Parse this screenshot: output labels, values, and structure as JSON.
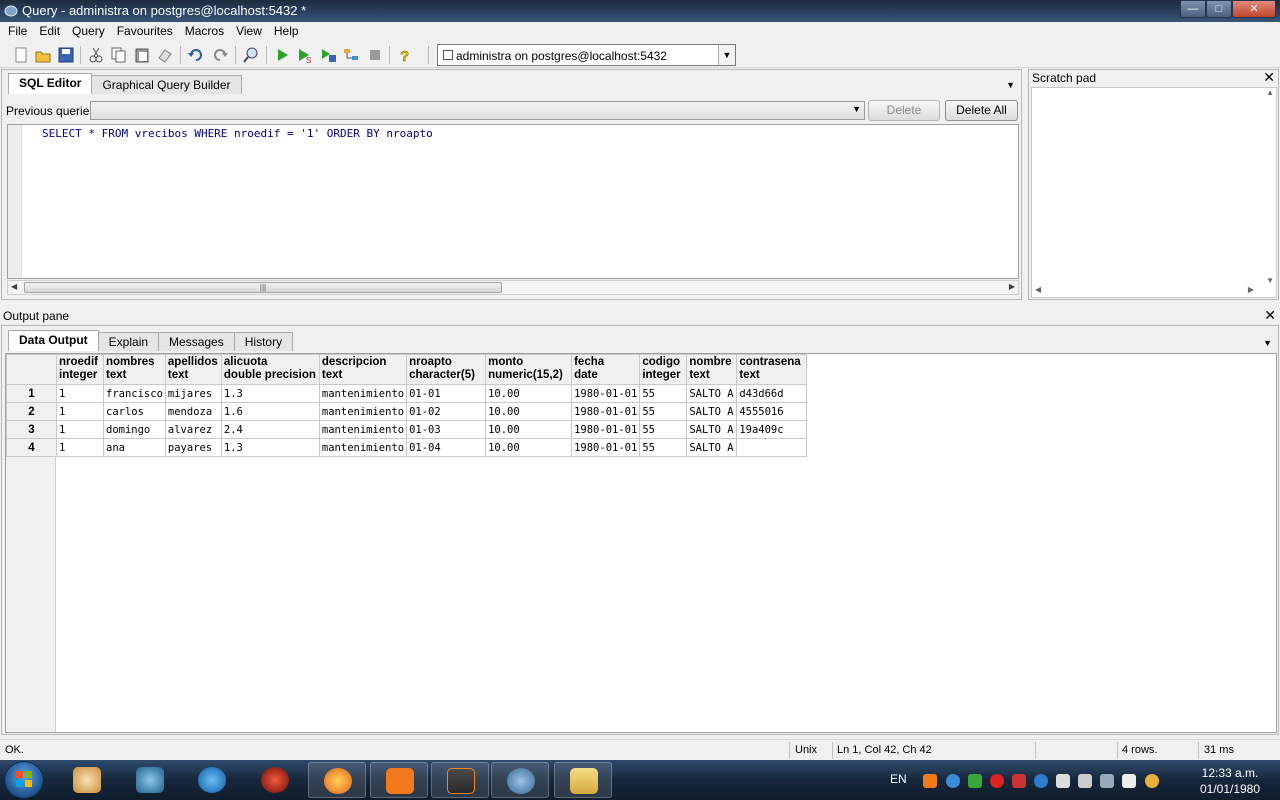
{
  "window": {
    "title": "Query - administra on postgres@localhost:5432 *",
    "minimize": "—",
    "maximize": "□",
    "close": "✕"
  },
  "menu": [
    "File",
    "Edit",
    "Query",
    "Favourites",
    "Macros",
    "View",
    "Help"
  ],
  "toolbar": {
    "icons": [
      "new-icon",
      "open-icon",
      "save-icon",
      "cut-icon",
      "copy-icon",
      "paste-icon",
      "clear-icon",
      "undo-icon",
      "redo-icon",
      "find-icon",
      "execute-icon",
      "execute-pgscript-icon",
      "execute-to-file-icon",
      "explain-icon",
      "cancel-icon",
      "help-icon"
    ],
    "connection": "administra on postgres@localhost:5432"
  },
  "editor": {
    "tabs": [
      "SQL Editor",
      "Graphical Query Builder"
    ],
    "active_tab": "SQL Editor",
    "previous_queries_label": "Previous queries",
    "previous_queries_value": "",
    "delete_label": "Delete",
    "delete_all_label": "Delete All",
    "sql": "SELECT * FROM vrecibos WHERE nroedif = '1' ORDER BY nroapto",
    "scroll_thumb": "|||"
  },
  "scratch_pad": {
    "title": "Scratch pad",
    "close": "✕"
  },
  "output": {
    "title": "Output pane",
    "close": "✕",
    "tabs": [
      "Data Output",
      "Explain",
      "Messages",
      "History"
    ],
    "active_tab": "Data Output",
    "columns": [
      {
        "name": "nroedif",
        "type": "integer"
      },
      {
        "name": "nombres",
        "type": "text"
      },
      {
        "name": "apellidos",
        "type": "text"
      },
      {
        "name": "alicuota",
        "type": "double precision"
      },
      {
        "name": "descripcion",
        "type": "text"
      },
      {
        "name": "nroapto",
        "type": "character(5)"
      },
      {
        "name": "monto",
        "type": "numeric(15,2)"
      },
      {
        "name": "fecha",
        "type": "date"
      },
      {
        "name": "codigo",
        "type": "integer"
      },
      {
        "name": "nombre",
        "type": "text"
      },
      {
        "name": "contrasena",
        "type": "text"
      }
    ],
    "rows": [
      {
        "num": "1",
        "cells": [
          "1",
          "francisco",
          "mijares",
          "1.3",
          "mantenimiento",
          "01-01",
          "10.00",
          "1980-01-01",
          "55",
          "SALTO A",
          "d43d66d"
        ]
      },
      {
        "num": "2",
        "cells": [
          "1",
          "carlos",
          "mendoza",
          "1.6",
          "mantenimiento",
          "01-02",
          "10.00",
          "1980-01-01",
          "55",
          "SALTO A",
          "4555016"
        ]
      },
      {
        "num": "3",
        "cells": [
          "1",
          "domingo",
          "alvarez",
          "2.4",
          "mantenimiento",
          "01-03",
          "10.00",
          "1980-01-01",
          "55",
          "SALTO A",
          "19a409c"
        ]
      },
      {
        "num": "4",
        "cells": [
          "1",
          "ana",
          "payares",
          "1.3",
          "mantenimiento",
          "01-04",
          "10.00",
          "1980-01-01",
          "55",
          "SALTO A",
          ""
        ]
      }
    ]
  },
  "status": {
    "message": "OK.",
    "line_endings": "Unix",
    "position": "Ln 1, Col 42, Ch 42",
    "rows": "4 rows.",
    "time": "31 ms"
  },
  "taskbar": {
    "apps": [
      "paint-app",
      "arduino-app",
      "eclipse-app",
      "app-red-gear",
      "firefox-app",
      "xampp-app",
      "sublime-app",
      "pgadmin-app",
      "explorer-app"
    ],
    "language": "EN",
    "time": "12:33 a.m.",
    "date": "01/01/1980"
  }
}
